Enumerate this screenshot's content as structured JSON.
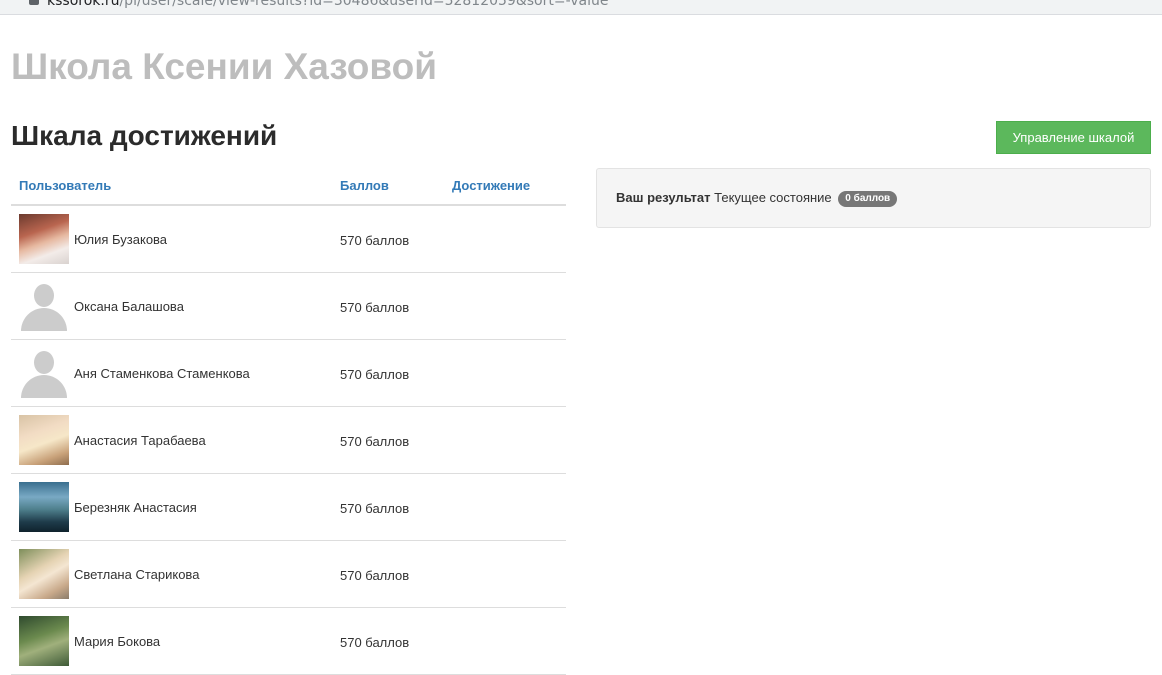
{
  "browser": {
    "url_domain": "kssorok.ru",
    "url_path": "/pl/user/scale/view-results?id=30486&userId=52812059&sort=-value"
  },
  "school_title": "Школа Ксении Хазовой",
  "page_title": "Шкала достижений",
  "manage_button": "Управление шкалой",
  "table": {
    "headers": {
      "user": "Пользователь",
      "score": "Баллов",
      "achievement": "Достижение"
    },
    "rows": [
      {
        "name": "Юлия Бузакова",
        "score": "570 баллов",
        "avatar": "photo"
      },
      {
        "name": "Оксана Балашова",
        "score": "570 баллов",
        "avatar": "user-placeholder-icon"
      },
      {
        "name": "Аня Стаменкова Стаменкова",
        "score": "570 баллов",
        "avatar": "user-placeholder-icon"
      },
      {
        "name": "Анастасия Тарабаева",
        "score": "570 баллов",
        "avatar": "photo"
      },
      {
        "name": "Березняк Анастасия",
        "score": "570 баллов",
        "avatar": "photo"
      },
      {
        "name": "Светлана Старикова",
        "score": "570 баллов",
        "avatar": "photo"
      },
      {
        "name": "Мария Бокова",
        "score": "570 баллов",
        "avatar": "photo"
      }
    ]
  },
  "result": {
    "label": "Ваш результат",
    "state": "Текущее состояние",
    "badge": "0 баллов"
  },
  "colors": {
    "link": "#337ab7",
    "button_green": "#5cb85c",
    "badge_gray": "#777777",
    "school_title": "#bdbdbd"
  }
}
